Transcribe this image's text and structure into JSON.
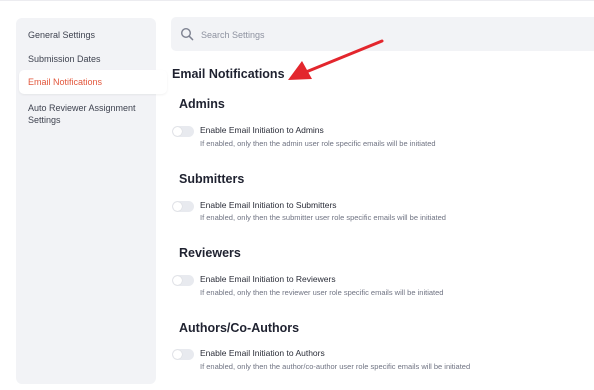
{
  "sidebar": {
    "items": [
      {
        "label": "General Settings",
        "active": false
      },
      {
        "label": "Submission Dates",
        "active": false
      },
      {
        "label": "Email Notifications",
        "active": true
      },
      {
        "label_line1": "Auto Reviewer Assignment",
        "label_line2": "Settings",
        "active": false
      }
    ]
  },
  "search": {
    "placeholder": "Search Settings"
  },
  "page": {
    "title": "Email Notifications"
  },
  "sections": [
    {
      "title": "Admins",
      "option_label": "Enable Email Initiation to Admins",
      "option_desc": "If enabled, only then the admin user role specific emails will be initiated",
      "enabled": false
    },
    {
      "title": "Submitters",
      "option_label": "Enable Email Initiation to Submitters",
      "option_desc": "If enabled, only then the submitter user role specific emails will be initiated",
      "enabled": false
    },
    {
      "title": "Reviewers",
      "option_label": "Enable Email Initiation to Reviewers",
      "option_desc": "If enabled, only then the reviewer user role specific emails will be initiated",
      "enabled": false
    },
    {
      "title": "Authors/Co-Authors",
      "option_label": "Enable Email Initiation to Authors",
      "option_desc": "If enabled, only then the author/co-author user role specific emails will be initiated",
      "enabled": false
    }
  ],
  "colors": {
    "accent": "#e2573c",
    "arrow": "#e3262d",
    "panel_bg": "#f2f3f6"
  }
}
